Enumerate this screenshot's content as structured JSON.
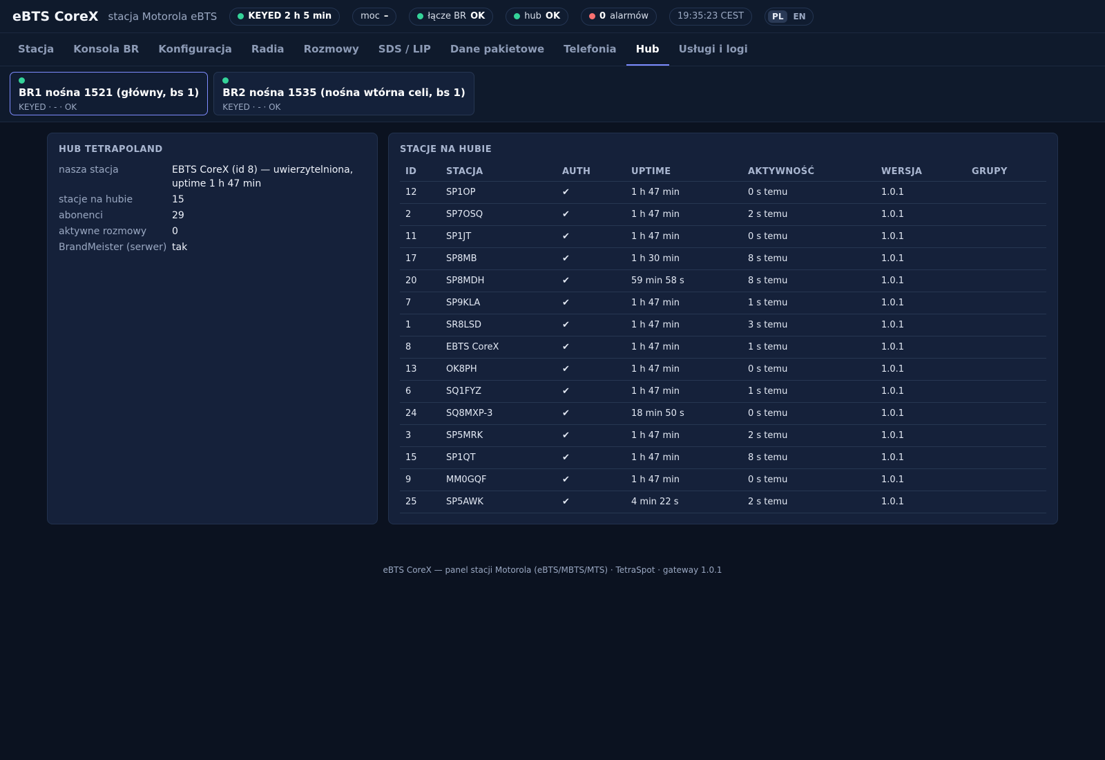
{
  "header": {
    "brand": "eBTS CoreX",
    "subtitle": "stacja Motorola eBTS",
    "status_keyed": "KEYED 2 h 5 min",
    "power_label": "moc",
    "power_value": "–",
    "br_link_label": "łącze BR",
    "br_link_value": "OK",
    "hub_label": "hub",
    "hub_value": "OK",
    "alarms_count": "0",
    "alarms_label": "alarmów",
    "clock": "19:35:23 CEST",
    "lang_pl": "PL",
    "lang_en": "EN",
    "colors": {
      "ok": "#34d399",
      "alarm": "#f87171",
      "accent": "#7c8cff"
    }
  },
  "tabs": [
    {
      "label": "Stacja"
    },
    {
      "label": "Konsola BR"
    },
    {
      "label": "Konfiguracja"
    },
    {
      "label": "Radia"
    },
    {
      "label": "Rozmowy"
    },
    {
      "label": "SDS / LIP"
    },
    {
      "label": "Dane pakietowe"
    },
    {
      "label": "Telefonia"
    },
    {
      "label": "Hub"
    },
    {
      "label": "Usługi i logi"
    }
  ],
  "active_tab": "Hub",
  "br_cards": [
    {
      "title": "BR1 nośna 1521 (główny, bs 1)",
      "meta": "KEYED · - · OK"
    },
    {
      "title": "BR2 nośna 1535 (nośna wtórna celi, bs 1)",
      "meta": "KEYED · - · OK"
    }
  ],
  "hub_panel": {
    "title": "HUB TETRAPOLAND",
    "rows": [
      {
        "key": "nasza stacja",
        "value": "EBTS CoreX (id 8) — uwierzytelniona, uptime 1 h 47 min"
      },
      {
        "key": "stacje na hubie",
        "value": "15"
      },
      {
        "key": "abonenci",
        "value": "29"
      },
      {
        "key": "aktywne rozmowy",
        "value": "0"
      },
      {
        "key": "BrandMeister (serwer)",
        "value": "tak"
      }
    ]
  },
  "stations_panel": {
    "title": "STACJE NA HUBIE",
    "columns": [
      "ID",
      "STACJA",
      "AUTH",
      "UPTIME",
      "AKTYWNOŚĆ",
      "WERSJA",
      "GRUPY"
    ],
    "rows": [
      [
        "12",
        "SP1OP",
        "✔",
        "1 h 47 min",
        "0 s temu",
        "1.0.1",
        ""
      ],
      [
        "2",
        "SP7OSQ",
        "✔",
        "1 h 47 min",
        "2 s temu",
        "1.0.1",
        ""
      ],
      [
        "11",
        "SP1JT",
        "✔",
        "1 h 47 min",
        "0 s temu",
        "1.0.1",
        ""
      ],
      [
        "17",
        "SP8MB",
        "✔",
        "1 h 30 min",
        "8 s temu",
        "1.0.1",
        ""
      ],
      [
        "20",
        "SP8MDH",
        "✔",
        "59 min 58 s",
        "8 s temu",
        "1.0.1",
        ""
      ],
      [
        "7",
        "SP9KLA",
        "✔",
        "1 h 47 min",
        "1 s temu",
        "1.0.1",
        ""
      ],
      [
        "1",
        "SR8LSD",
        "✔",
        "1 h 47 min",
        "3 s temu",
        "1.0.1",
        ""
      ],
      [
        "8",
        "EBTS CoreX",
        "✔",
        "1 h 47 min",
        "1 s temu",
        "1.0.1",
        ""
      ],
      [
        "13",
        "OK8PH",
        "✔",
        "1 h 47 min",
        "0 s temu",
        "1.0.1",
        ""
      ],
      [
        "6",
        "SQ1FYZ",
        "✔",
        "1 h 47 min",
        "1 s temu",
        "1.0.1",
        ""
      ],
      [
        "24",
        "SQ8MXP-3",
        "✔",
        "18 min 50 s",
        "0 s temu",
        "1.0.1",
        ""
      ],
      [
        "3",
        "SP5MRK",
        "✔",
        "1 h 47 min",
        "2 s temu",
        "1.0.1",
        ""
      ],
      [
        "15",
        "SP1QT",
        "✔",
        "1 h 47 min",
        "8 s temu",
        "1.0.1",
        ""
      ],
      [
        "9",
        "MM0GQF",
        "✔",
        "1 h 47 min",
        "0 s temu",
        "1.0.1",
        ""
      ],
      [
        "25",
        "SP5AWK",
        "✔",
        "4 min 22 s",
        "2 s temu",
        "1.0.1",
        ""
      ]
    ]
  },
  "footer": "eBTS CoreX — panel stacji Motorola (eBTS/MBTS/MTS) · TetraSpot · gateway 1.0.1"
}
